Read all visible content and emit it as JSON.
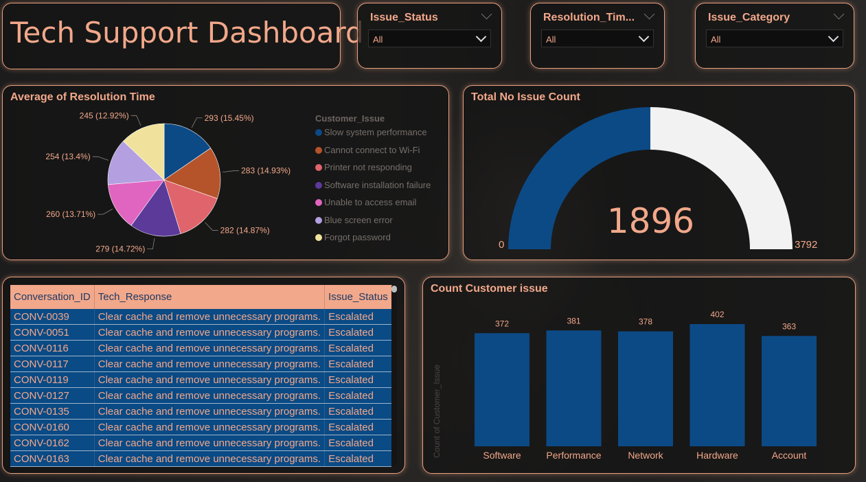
{
  "dashboard": {
    "title": "Tech Support Dashboard"
  },
  "slicers": [
    {
      "label": "Issue_Status",
      "value": "All"
    },
    {
      "label": "Resolution_Tim...",
      "value": "All"
    },
    {
      "label": "Issue_Category",
      "value": "All"
    }
  ],
  "pie": {
    "title": "Average of Resolution Time",
    "legend_title": "Customer_Issue",
    "colors": [
      "#0c4a86",
      "#b5532a",
      "#e0646b",
      "#5b3a9a",
      "#e065c0",
      "#b49fe0",
      "#f0e29c"
    ],
    "chart_data": {
      "type": "pie",
      "labels": [
        "Slow system performance",
        "Cannot connect to Wi-Fi",
        "Printer not responding",
        "Software installation failure",
        "Unable to access email",
        "Blue screen error",
        "Forgot password"
      ],
      "values": [
        293,
        283,
        282,
        279,
        260,
        254,
        245
      ],
      "data_labels": [
        "293 (15.45%)",
        "283 (14.93%)",
        "282 (14.87%)",
        "279 (14.72%)",
        "260 (13.71%)",
        "254 (13.4%)",
        "245 (12.92%)"
      ]
    }
  },
  "gauge": {
    "title": "Total No Issue Count",
    "value": 1896,
    "value_label": "1896",
    "min_label": "0",
    "max_label": "3792",
    "min": 0,
    "max": 3792,
    "fill_color": "#0c4a86",
    "track_color": "#f2f2f2"
  },
  "table": {
    "columns": [
      "Conversation_ID",
      "Tech_Response",
      "Issue_Status"
    ],
    "rows": [
      [
        "CONV-0039",
        "Clear cache and remove unnecessary programs.",
        "Escalated"
      ],
      [
        "CONV-0051",
        "Clear cache and remove unnecessary programs.",
        "Escalated"
      ],
      [
        "CONV-0116",
        "Clear cache and remove unnecessary programs.",
        "Escalated"
      ],
      [
        "CONV-0117",
        "Clear cache and remove unnecessary programs.",
        "Escalated"
      ],
      [
        "CONV-0119",
        "Clear cache and remove unnecessary programs.",
        "Escalated"
      ],
      [
        "CONV-0127",
        "Clear cache and remove unnecessary programs.",
        "Escalated"
      ],
      [
        "CONV-0135",
        "Clear cache and remove unnecessary programs.",
        "Escalated"
      ],
      [
        "CONV-0160",
        "Clear cache and remove unnecessary programs.",
        "Escalated"
      ],
      [
        "CONV-0162",
        "Clear cache and remove unnecessary programs.",
        "Escalated"
      ],
      [
        "CONV-0163",
        "Clear cache and remove unnecessary programs.",
        "Escalated"
      ]
    ]
  },
  "bar": {
    "title": "Count Customer issue",
    "ylabel": "Count of Customer_Issue",
    "color": "#0c4a86",
    "chart_data": {
      "type": "bar",
      "categories": [
        "Software",
        "Performance",
        "Network",
        "Hardware",
        "Account"
      ],
      "values": [
        372,
        381,
        378,
        402,
        363
      ],
      "ylim": [
        0,
        402
      ]
    }
  }
}
